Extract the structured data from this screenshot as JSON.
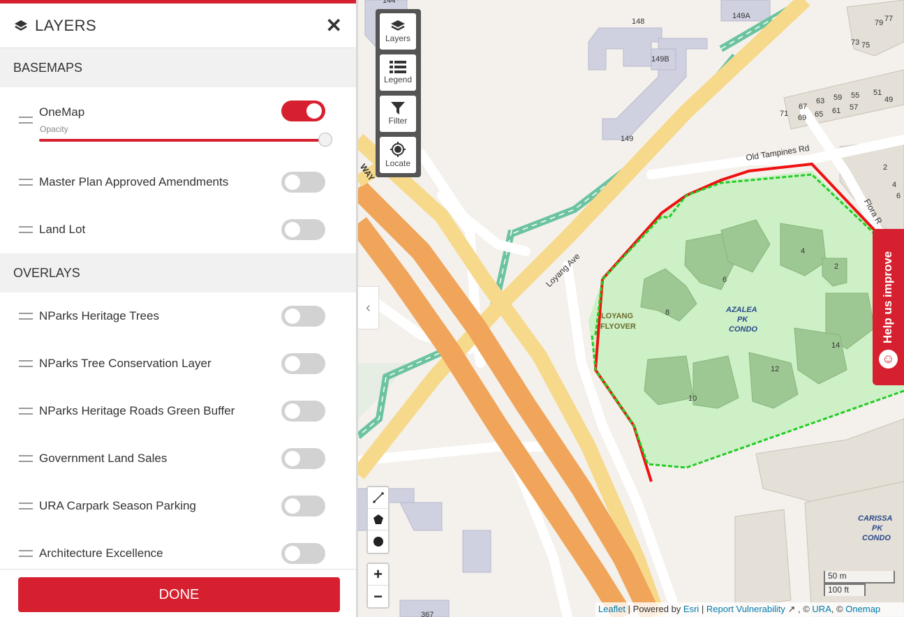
{
  "panel": {
    "title": "LAYERS",
    "close_icon": "close-icon",
    "basemaps_heading": "BASEMAPS",
    "basemaps": [
      {
        "label": "OneMap",
        "on": true,
        "opacity_label": "Opacity",
        "opacity": 1.0
      }
    ],
    "basemap_rest": [
      {
        "label": "Master Plan Approved Amendments",
        "on": false
      },
      {
        "label": "Land Lot",
        "on": false
      }
    ],
    "overlays_heading": "OVERLAYS",
    "overlays": [
      {
        "label": "NParks Heritage Trees",
        "on": false
      },
      {
        "label": "NParks Tree Conservation Layer",
        "on": false
      },
      {
        "label": "NParks Heritage Roads Green Buffer",
        "on": false
      },
      {
        "label": "Government Land Sales",
        "on": false
      },
      {
        "label": "URA Carpark Season Parking",
        "on": false
      },
      {
        "label": "Architecture Excellence",
        "on": false
      }
    ],
    "done_label": "DONE"
  },
  "toolbar": {
    "layers": "Layers",
    "legend": "Legend",
    "filter": "Filter",
    "locate": "Locate"
  },
  "help": {
    "label": "Help us improve"
  },
  "map": {
    "labels": {
      "old_tampines": "Old Tampines Rd",
      "loyang_ave": "Loyang Ave",
      "flora": "Flora R",
      "way": "WAY",
      "loyang_flyover_1": "LOYANG",
      "loyang_flyover_2": "FLYOVER",
      "azalea_1": "AZALEA",
      "azalea_2": "PK",
      "azalea_3": "CONDO",
      "carissa_1": "CARISSA",
      "carissa_2": "PK",
      "carissa_3": "CONDO",
      "b148": "148",
      "b149a": "149A",
      "b149b": "149B",
      "b149": "149",
      "b367": "367",
      "b144": "144",
      "b2": "2",
      "b4": "4",
      "b6": "6",
      "b8": "8",
      "b10": "10",
      "b12": "12",
      "b14": "14",
      "p4": "4",
      "p2": "2",
      "p6": "6",
      "h79": "79",
      "h77": "77",
      "h73": "73",
      "h75": "75",
      "h55": "55",
      "h51": "51",
      "h49": "49",
      "h59": "59",
      "h57": "57",
      "h63": "63",
      "h61": "61",
      "h67": "67",
      "h65": "65",
      "h71": "71",
      "h69": "69"
    },
    "scale": {
      "metric": "50 m",
      "imperial": "100 ft"
    },
    "attribution": {
      "leaflet": "Leaflet",
      "sep1": " | Powered by ",
      "esri": "Esri",
      "sep2": " | ",
      "report": "Report Vulnerability",
      "sep3": " ↗ , © ",
      "ura": "URA",
      "sep4": ", © ",
      "onemap": "Onemap"
    },
    "colors": {
      "expressway": "#f0a55a",
      "arterial": "#f7d98c",
      "park_connector": "#6cc3a0",
      "boundary_red": "#ee1111",
      "boundary_green": "#22cc22",
      "parcel_fill": "#c9efc3",
      "accent": "#d6202f"
    }
  }
}
